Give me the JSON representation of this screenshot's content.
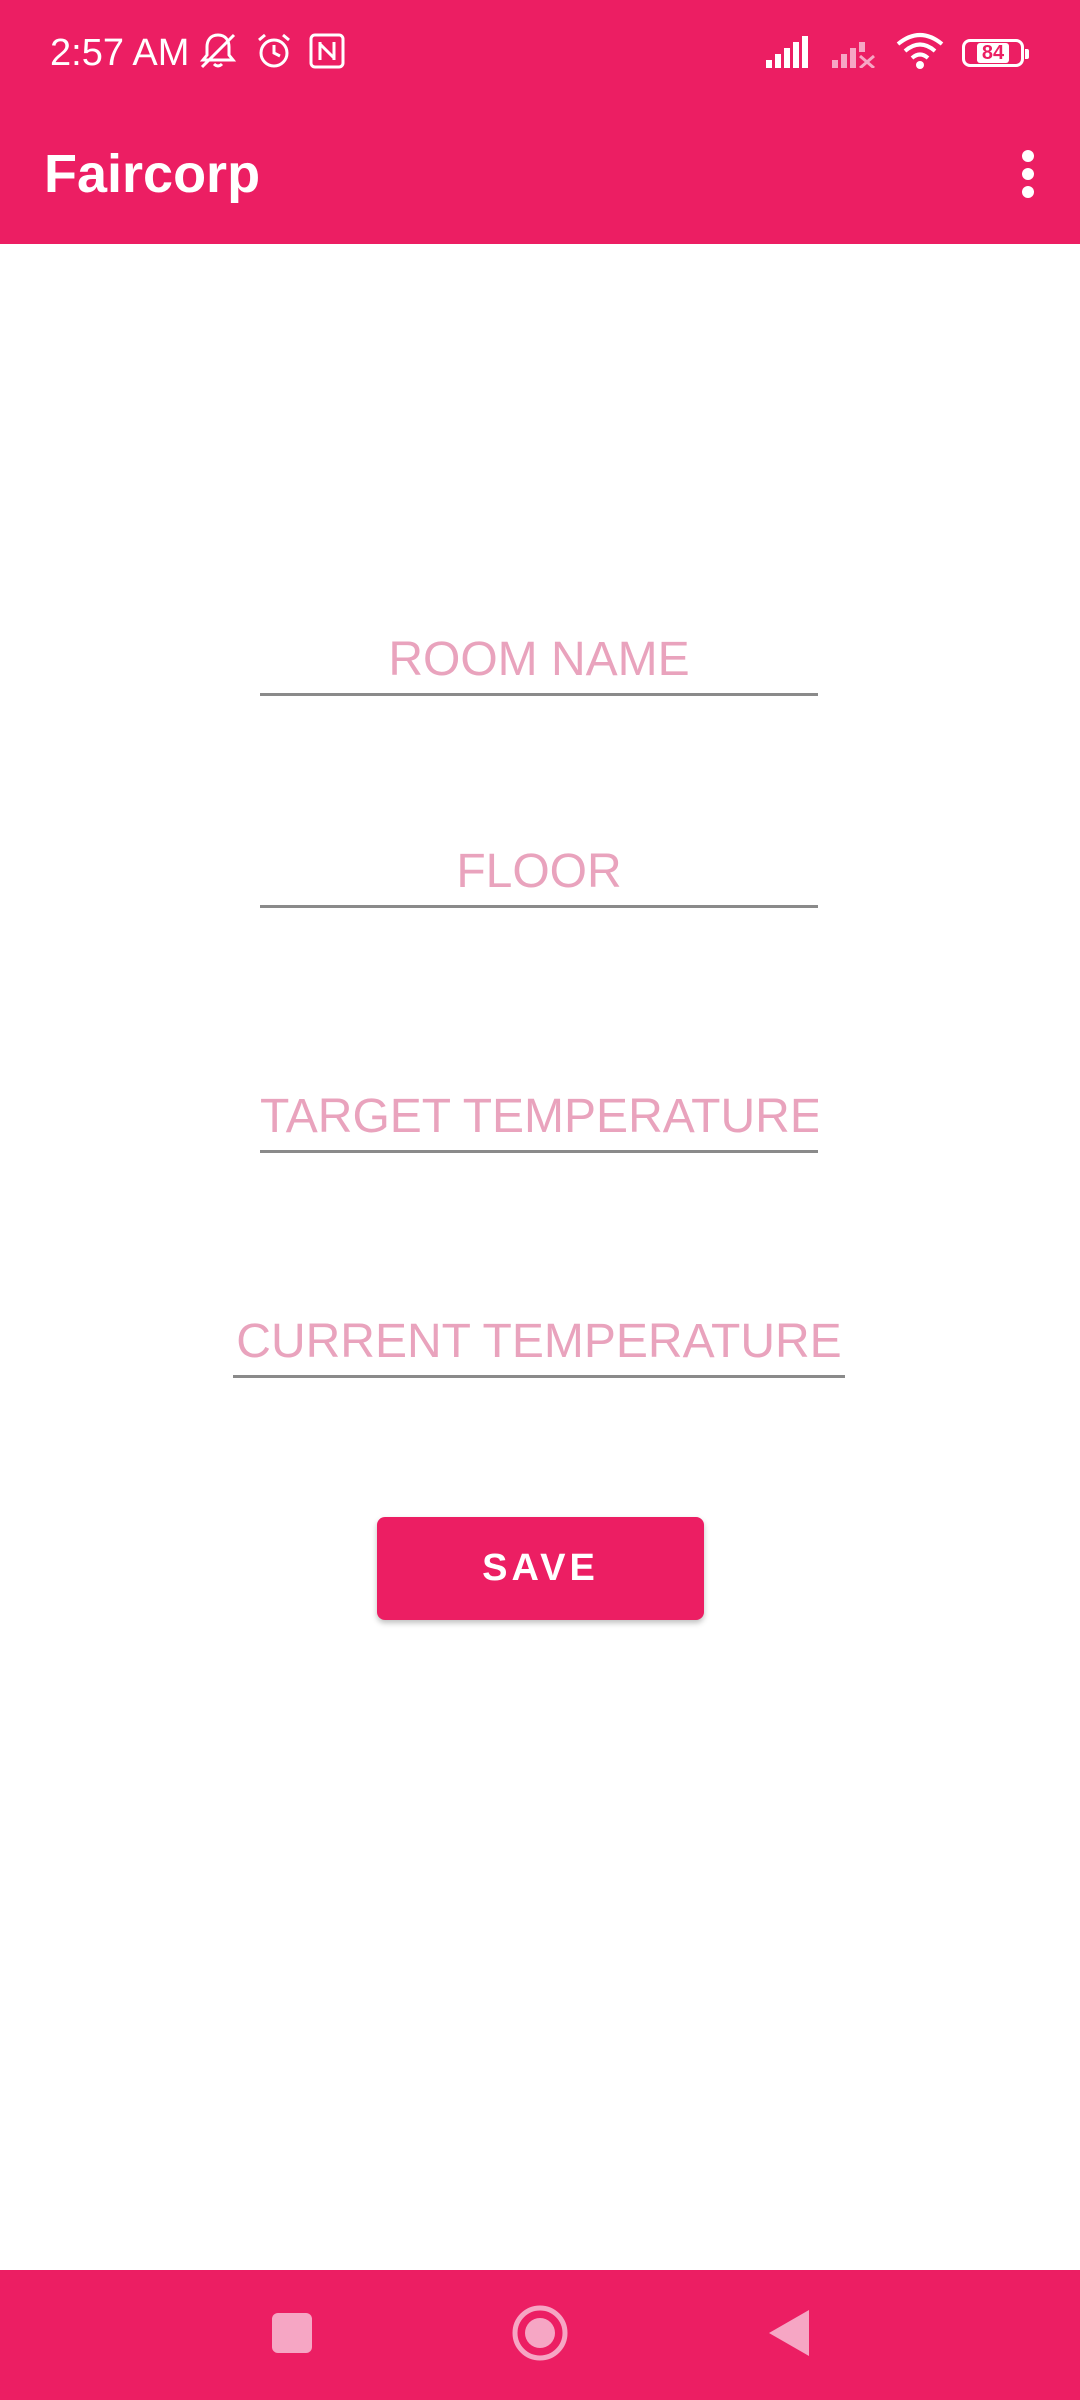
{
  "status_bar": {
    "time": "2:57 AM",
    "battery_level": "84",
    "icons_left": [
      "vibrate-off-icon",
      "alarm-icon",
      "nfc-icon"
    ],
    "icons_right": [
      "signal-icon",
      "signal-off-icon",
      "wifi-icon",
      "battery-icon"
    ]
  },
  "app_bar": {
    "title": "Faircorp",
    "menu_icon": "more-vert-icon"
  },
  "form": {
    "room_name": {
      "placeholder": "ROOM NAME",
      "value": ""
    },
    "floor": {
      "placeholder": "FLOOR",
      "value": ""
    },
    "target_temperature": {
      "placeholder": "TARGET TEMPERATURE",
      "value": ""
    },
    "current_temperature": {
      "placeholder": "CURRENT TEMPERATURE",
      "value": ""
    },
    "save_label": "SAVE"
  },
  "nav_bar": {
    "buttons": [
      "recents-icon",
      "home-icon",
      "back-icon"
    ]
  },
  "colors": {
    "primary": "#EC1E63",
    "placeholder": "#E9A3BD",
    "underline": "#8a8a8a",
    "background": "#ffffff"
  }
}
